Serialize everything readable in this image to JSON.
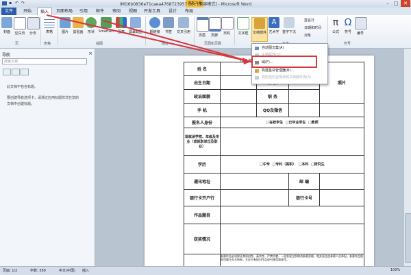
{
  "window": {
    "title": "IMG6b0836e71caea4768723957.doc [兼容模式] - Microsoft Word",
    "context_tab": "表格工具",
    "buttons": {
      "minimize": "–",
      "maximize": "□",
      "close": "✕"
    }
  },
  "tabs": [
    "文件",
    "开始",
    "插入",
    "页面布局",
    "引用",
    "邮件",
    "审阅",
    "视图",
    "开发工具",
    "设计",
    "布局"
  ],
  "ribbon": {
    "buttons": [
      "封面",
      "空白页",
      "分页",
      "表格",
      "图片",
      "剪贴画",
      "形状",
      "SmartArt",
      "图表",
      "屏幕截图",
      "超链接",
      "书签",
      "交叉引用",
      "页眉",
      "页脚",
      "页码",
      "文本框",
      "文档部件",
      "艺术字",
      "首字下沉",
      "公式",
      "符号",
      "编号"
    ],
    "small_buttons": [
      "签名行",
      "日期和时间",
      "对象"
    ],
    "groups": [
      "页",
      "表格",
      "插图",
      "链接",
      "页眉和页脚",
      "文本",
      "符号"
    ],
    "colors": {
      "accent": "#2a5caa",
      "highlight": "#d8363b"
    }
  },
  "nav": {
    "title": "导航",
    "search_placeholder": "搜索文档",
    "line1": "此文档不包含标题。",
    "line2": "要创建导航选项卡，请通过应用标题样式在您的",
    "line3": "文档中创建标题。"
  },
  "menu": {
    "items": [
      {
        "label": "自动图文集(A)",
        "disabled": false
      },
      {
        "label": "文档属性(D)",
        "disabled": true
      },
      {
        "label": "域(F)...",
        "disabled": false
      },
      {
        "label": "构建基块管理器(B)...",
        "disabled": false
      },
      {
        "label": "将所选内容保存到文档部件库(S)...",
        "disabled": true
      }
    ]
  },
  "form": {
    "heading_fragment": "作品名",
    "rows": {
      "name": "姓    名",
      "gender": "性    别",
      "birthdate": "出生日期",
      "ethnicity": "民    族",
      "photo": "照片",
      "political": "政治面貌",
      "position": "职    务",
      "phone": "手    机",
      "qq": "QQ及微信",
      "identity": "报名人身份",
      "identity_options": [
        "在校学生",
        "已毕业学生",
        "教师"
      ],
      "school": "现就读学校、年级及专业（或就职单位及职业）",
      "education": "学历",
      "education_options": [
        "中专",
        "专科（高职）",
        "本科",
        "研究生"
      ],
      "address": "通讯地址",
      "postcode": "邮    编",
      "bank": "银行卡开户行",
      "card": "银行卡号",
      "work_title": "作品题目",
      "awards": "获奖情况",
      "footnote": "参赛作品必须保证其原创性、真实性，严禁抄袭，一经发现立即取消参赛资格，相关责任由参赛人员承担。参赛作品版权归属主办方所有，主办方有权对作品进行使用和宣传。"
    }
  },
  "status": {
    "page": "页面: 1/2",
    "words": "字数: 389",
    "lang": "中文(中国)",
    "mode": "插入",
    "zoom": "100%"
  }
}
